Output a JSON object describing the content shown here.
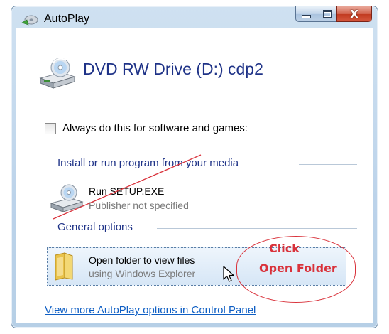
{
  "window": {
    "title": "AutoPlay",
    "buttons": {
      "minimize": "minimize",
      "maximize": "maximize",
      "close": "X"
    }
  },
  "drive": {
    "title": "DVD RW Drive (D:) cdp2"
  },
  "always_checkbox": {
    "label": "Always do this for software and games:",
    "checked": false
  },
  "install_section": {
    "heading": "Install or run program from your media",
    "item": {
      "title": "Run SETUP.EXE",
      "subtitle": "Publisher not specified"
    }
  },
  "general_section": {
    "heading": "General options",
    "item": {
      "title": "Open folder to view files",
      "subtitle": "using Windows Explorer"
    }
  },
  "annotation": {
    "line1": "Click",
    "line2": "Open Folder",
    "color": "#d9323b"
  },
  "footer_link": "View more AutoPlay options in Control Panel",
  "colors": {
    "heading_blue": "#1e3287",
    "link_blue": "#0f5fc4",
    "close_red": "#c0391f"
  }
}
